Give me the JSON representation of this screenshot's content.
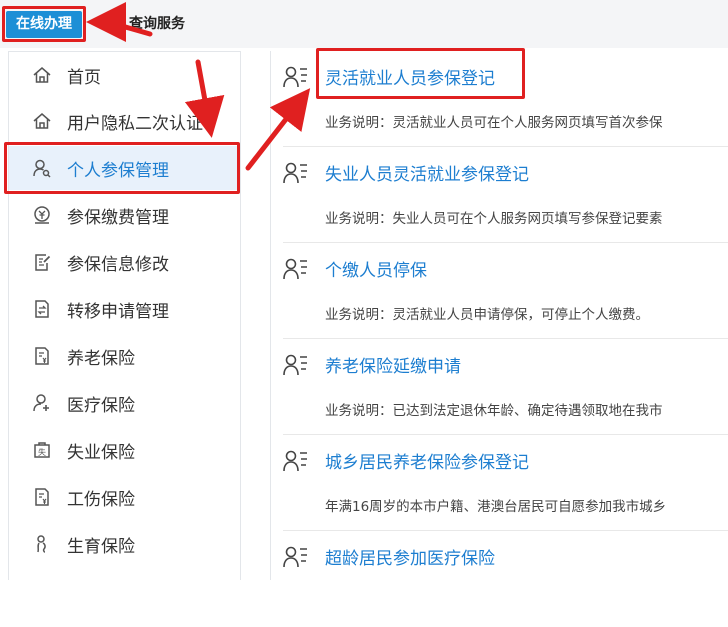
{
  "topbar": {
    "online_tab": "在线办理",
    "query_tab": "查询服务"
  },
  "sidebar": {
    "items": [
      {
        "label": "首页",
        "icon": "home-icon"
      },
      {
        "label": "用户隐私二次认证",
        "icon": "home-icon"
      },
      {
        "label": "个人参保管理",
        "icon": "user-search-icon",
        "active": true
      },
      {
        "label": "参保缴费管理",
        "icon": "payment-icon"
      },
      {
        "label": "参保信息修改",
        "icon": "edit-document-icon"
      },
      {
        "label": "转移申请管理",
        "icon": "transfer-icon"
      },
      {
        "label": "养老保险",
        "icon": "pension-document-icon"
      },
      {
        "label": "医疗保险",
        "icon": "medical-person-icon"
      },
      {
        "label": "失业保险",
        "icon": "unemployment-icon"
      },
      {
        "label": "工伤保险",
        "icon": "injury-document-icon"
      },
      {
        "label": "生育保险",
        "icon": "maternity-icon"
      }
    ]
  },
  "services": [
    {
      "title": "灵活就业人员参保登记",
      "desc": "业务说明：灵活就业人员可在个人服务网页填写首次参保"
    },
    {
      "title": "失业人员灵活就业参保登记",
      "desc": "业务说明：失业人员可在个人服务网页填写参保登记要素"
    },
    {
      "title": "个缴人员停保",
      "desc": "业务说明：灵活就业人员申请停保，可停止个人缴费。"
    },
    {
      "title": "养老保险延缴申请",
      "desc": "业务说明：已达到法定退休年龄、确定待遇领取地在我市"
    },
    {
      "title": "城乡居民养老保险参保登记",
      "desc": "年满16周岁的本市户籍、港澳台居民可自愿参加我市城乡"
    },
    {
      "title": "超龄居民参加医疗保险",
      "desc": ""
    }
  ],
  "colors": {
    "accent": "#1d7ed0",
    "tab_blue": "#1d8fd6",
    "annotation_red": "#e02020"
  }
}
